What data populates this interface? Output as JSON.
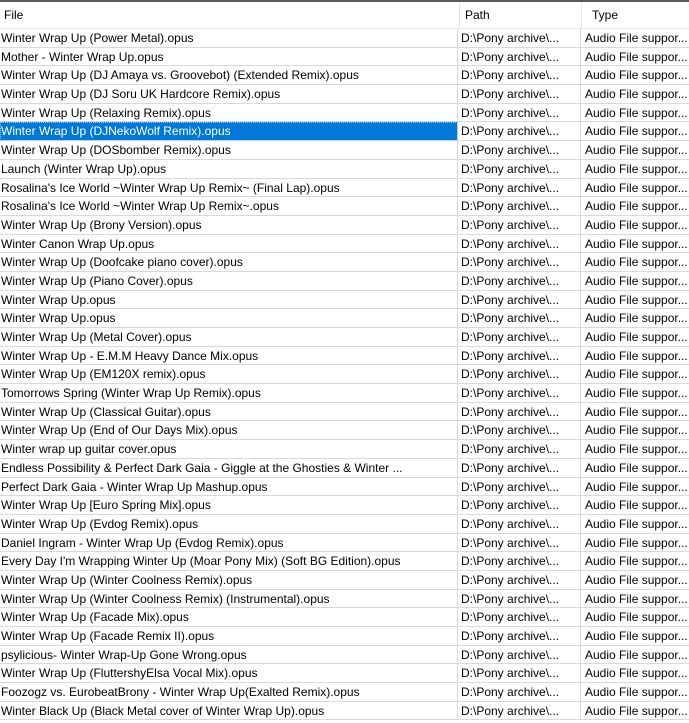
{
  "columns": {
    "file": "File",
    "path": "Path",
    "type": "Type"
  },
  "rows": [
    {
      "file": "Winter Wrap Up (Power Metal).opus",
      "path": "D:\\Pony archive\\...",
      "type": "Audio File suppor...",
      "selected": false
    },
    {
      "file": "Mother - Winter Wrap Up.opus",
      "path": "D:\\Pony archive\\...",
      "type": "Audio File suppor...",
      "selected": false
    },
    {
      "file": "Winter Wrap Up (DJ Amaya vs. Groovebot) (Extended Remix).opus",
      "path": "D:\\Pony archive\\...",
      "type": "Audio File suppor...",
      "selected": false
    },
    {
      "file": "Winter Wrap Up (DJ Soru UK Hardcore Remix).opus",
      "path": "D:\\Pony archive\\...",
      "type": "Audio File suppor...",
      "selected": false
    },
    {
      "file": "Winter Wrap Up (Relaxing Remix).opus",
      "path": "D:\\Pony archive\\...",
      "type": "Audio File suppor...",
      "selected": false
    },
    {
      "file": "Winter Wrap Up (DJNekoWolf Remix).opus",
      "path": "D:\\Pony archive\\...",
      "type": "Audio File suppor...",
      "selected": true
    },
    {
      "file": "Winter Wrap Up (DOSbomber Remix).opus",
      "path": "D:\\Pony archive\\...",
      "type": "Audio File suppor...",
      "selected": false
    },
    {
      "file": "Launch (Winter Wrap Up).opus",
      "path": "D:\\Pony archive\\...",
      "type": "Audio File suppor...",
      "selected": false
    },
    {
      "file": "Rosalina's Ice World ~Winter Wrap Up Remix~ (Final Lap).opus",
      "path": "D:\\Pony archive\\...",
      "type": "Audio File suppor...",
      "selected": false
    },
    {
      "file": "Rosalina's Ice World ~Winter Wrap Up Remix~.opus",
      "path": "D:\\Pony archive\\...",
      "type": "Audio File suppor...",
      "selected": false
    },
    {
      "file": "Winter Wrap Up (Brony Version).opus",
      "path": "D:\\Pony archive\\...",
      "type": "Audio File suppor...",
      "selected": false
    },
    {
      "file": "Winter Canon Wrap Up.opus",
      "path": "D:\\Pony archive\\...",
      "type": "Audio File suppor...",
      "selected": false
    },
    {
      "file": "Winter Wrap Up (Doofcake piano cover).opus",
      "path": "D:\\Pony archive\\...",
      "type": "Audio File suppor...",
      "selected": false
    },
    {
      "file": "Winter Wrap Up (Piano Cover).opus",
      "path": "D:\\Pony archive\\...",
      "type": "Audio File suppor...",
      "selected": false
    },
    {
      "file": "Winter Wrap Up.opus",
      "path": "D:\\Pony archive\\...",
      "type": "Audio File suppor...",
      "selected": false
    },
    {
      "file": "Winter Wrap Up.opus",
      "path": "D:\\Pony archive\\...",
      "type": "Audio File suppor...",
      "selected": false
    },
    {
      "file": "Winter Wrap Up (Metal Cover).opus",
      "path": "D:\\Pony archive\\...",
      "type": "Audio File suppor...",
      "selected": false
    },
    {
      "file": "Winter Wrap Up - E.M.M Heavy Dance Mix.opus",
      "path": "D:\\Pony archive\\...",
      "type": "Audio File suppor...",
      "selected": false
    },
    {
      "file": "Winter Wrap Up (EM120X remix).opus",
      "path": "D:\\Pony archive\\...",
      "type": "Audio File suppor...",
      "selected": false
    },
    {
      "file": "Tomorrows Spring (Winter Wrap Up Remix).opus",
      "path": "D:\\Pony archive\\...",
      "type": "Audio File suppor...",
      "selected": false
    },
    {
      "file": "Winter Wrap Up (Classical Guitar).opus",
      "path": "D:\\Pony archive\\...",
      "type": "Audio File suppor...",
      "selected": false
    },
    {
      "file": "Winter Wrap Up (End of Our Days Mix).opus",
      "path": "D:\\Pony archive\\...",
      "type": "Audio File suppor...",
      "selected": false
    },
    {
      "file": "Winter wrap up guitar cover.opus",
      "path": "D:\\Pony archive\\...",
      "type": "Audio File suppor...",
      "selected": false
    },
    {
      "file": "Endless Possibility & Perfect Dark Gaia - Giggle at the Ghosties & Winter ...",
      "path": "D:\\Pony archive\\...",
      "type": "Audio File suppor...",
      "selected": false
    },
    {
      "file": "Perfect Dark Gaia - Winter Wrap Up Mashup.opus",
      "path": "D:\\Pony archive\\...",
      "type": "Audio File suppor...",
      "selected": false
    },
    {
      "file": "Winter Wrap Up [Euro Spring Mix].opus",
      "path": "D:\\Pony archive\\...",
      "type": "Audio File suppor...",
      "selected": false
    },
    {
      "file": "Winter Wrap Up (Evdog Remix).opus",
      "path": "D:\\Pony archive\\...",
      "type": "Audio File suppor...",
      "selected": false
    },
    {
      "file": "Daniel Ingram - Winter Wrap Up (Evdog Remix).opus",
      "path": "D:\\Pony archive\\...",
      "type": "Audio File suppor...",
      "selected": false
    },
    {
      "file": "Every Day I'm Wrapping Winter Up (Moar Pony Mix) (Soft BG Edition).opus",
      "path": "D:\\Pony archive\\...",
      "type": "Audio File suppor...",
      "selected": false
    },
    {
      "file": "Winter Wrap Up (Winter Coolness Remix).opus",
      "path": "D:\\Pony archive\\...",
      "type": "Audio File suppor...",
      "selected": false
    },
    {
      "file": "Winter Wrap Up (Winter Coolness Remix) (Instrumental).opus",
      "path": "D:\\Pony archive\\...",
      "type": "Audio File suppor...",
      "selected": false
    },
    {
      "file": "Winter Wrap Up (Facade Mix).opus",
      "path": "D:\\Pony archive\\...",
      "type": "Audio File suppor...",
      "selected": false
    },
    {
      "file": "Winter Wrap Up (Facade Remix II).opus",
      "path": "D:\\Pony archive\\...",
      "type": "Audio File suppor...",
      "selected": false
    },
    {
      "file": "psylicious- Winter Wrap-Up Gone Wrong.opus",
      "path": "D:\\Pony archive\\...",
      "type": "Audio File suppor...",
      "selected": false
    },
    {
      "file": "Winter Wrap Up (FluttershyElsa Vocal Mix).opus",
      "path": "D:\\Pony archive\\...",
      "type": "Audio File suppor...",
      "selected": false
    },
    {
      "file": "Foozogz vs. EurobeatBrony - Winter Wrap Up(Exalted Remix).opus",
      "path": "D:\\Pony archive\\...",
      "type": "Audio File suppor...",
      "selected": false
    },
    {
      "file": "Winter Black Up (Black Metal cover of Winter Wrap Up).opus",
      "path": "D:\\Pony archive\\...",
      "type": "Audio File suppor...",
      "selected": false
    }
  ]
}
